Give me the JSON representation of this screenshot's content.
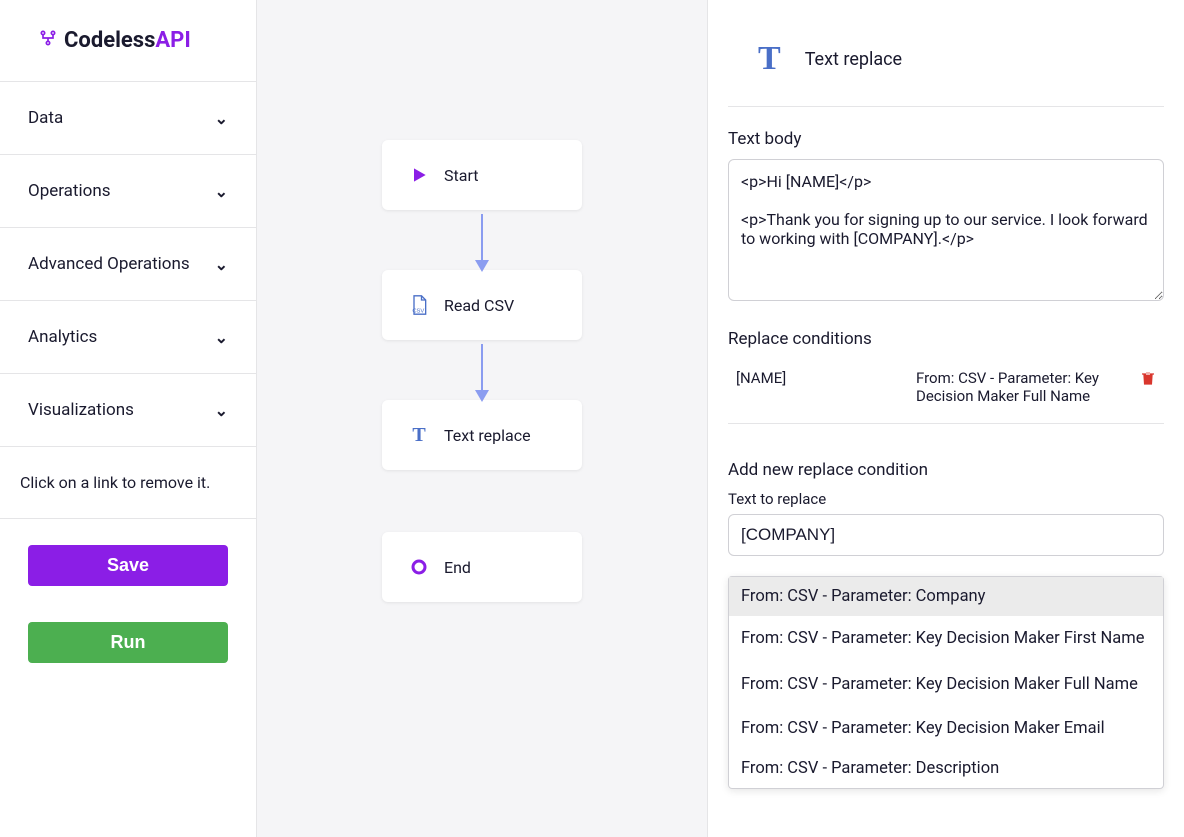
{
  "logo": {
    "brand": "Codeless",
    "suffix": "API"
  },
  "sidebar": {
    "items": [
      {
        "label": "Data"
      },
      {
        "label": "Operations"
      },
      {
        "label": "Advanced Operations"
      },
      {
        "label": "Analytics"
      },
      {
        "label": "Visualizations"
      }
    ],
    "hint": "Click on a link to remove it.",
    "saveLabel": "Save",
    "runLabel": "Run"
  },
  "nodes": {
    "start": "Start",
    "readcsv": "Read CSV",
    "textreplace": "Text replace",
    "end": "End"
  },
  "panel": {
    "title": "Text replace",
    "textBodyLabel": "Text body",
    "textBodyValue": "<p>Hi [NAME]</p>\n\n<p>Thank you for signing up to our service. I look forward to working with [COMPANY].</p>",
    "replaceConditionsLabel": "Replace conditions",
    "conditions": [
      {
        "key": "[NAME]",
        "from": "From: CSV - Parameter: Key Decision Maker Full Name"
      }
    ],
    "addNewLabel": "Add new replace condition",
    "textToReplaceLabel": "Text to replace",
    "textToReplaceValue": "[COMPANY]",
    "dropdown": [
      "From: CSV - Parameter: Company",
      "From: CSV - Parameter: Key Decision Maker First Name",
      "From: CSV - Parameter: Key Decision Maker Full Name",
      "From: CSV - Parameter: Key Decision Maker Email",
      "From: CSV - Parameter: Description"
    ]
  }
}
